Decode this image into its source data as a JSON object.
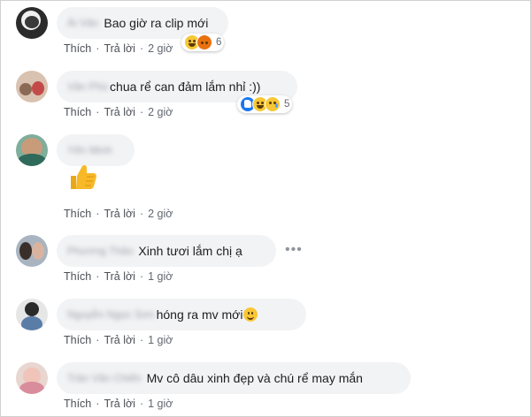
{
  "actions": {
    "like_label": "Thích",
    "reply_label": "Trả lời",
    "separator": "·"
  },
  "comments": [
    {
      "author": "Ái Vân",
      "text": "Bao giờ ra clip mới",
      "time": "2 giờ",
      "reactions": [
        "haha-icon",
        "angry-icon"
      ],
      "reaction_count": "6"
    },
    {
      "author": "Văn Phú",
      "text": "chua rể can đảm lắm nhỉ :))",
      "time": "2 giờ",
      "reactions": [
        "like-icon",
        "haha-icon",
        "sad-icon"
      ],
      "reaction_count": "5"
    },
    {
      "author": "Yến Minh",
      "text": "",
      "sticker": "thumbs-up-sticker",
      "time": "2 giờ"
    },
    {
      "author": "Phương Thảo",
      "text": "Xinh tươi lắm chị ạ",
      "time": "1 giờ"
    },
    {
      "author": "Nguyễn Ngọc Sơn",
      "text": "hóng ra mv mới",
      "time": "1 giờ"
    },
    {
      "author": "Trần Văn Chiến",
      "text": "Mv cô dâu xinh đẹp và chú rể may mắn",
      "time": "1 giờ"
    }
  ],
  "more_options_icon": "ellipsis-icon",
  "colors": {
    "bubble_bg": "#f2f3f5",
    "link": "#4b4f56",
    "like_blue": "#1877f2",
    "emoji_yellow": "#f7c736"
  }
}
